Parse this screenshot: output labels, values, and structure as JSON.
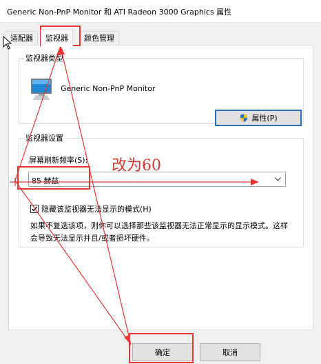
{
  "window": {
    "title": "Generic Non-PnP Monitor 和 ATI Radeon 3000 Graphics 属性"
  },
  "tabs": [
    {
      "label": "适配器"
    },
    {
      "label": "监视器"
    },
    {
      "label": "颜色管理"
    }
  ],
  "monitor_type": {
    "legend": "监视器类型",
    "name": "Generic Non-PnP Monitor",
    "properties_label": "属性(P)"
  },
  "monitor_settings": {
    "legend": "监视器设置",
    "refresh_label": "屏幕刷新频率(S):",
    "refresh_value": "85 赫兹",
    "hide_modes_label": "隐藏该监视器无法显示的模式(H)",
    "hide_modes_checked": true,
    "description": "如果不复选该项，则你可以选择那些该监视器无法正常显示的显示模式。这样会导致无法显示并且/或者损坏硬件。"
  },
  "buttons": {
    "ok_label": "确定",
    "cancel_label": "取消"
  },
  "annotation": {
    "text": "改为60",
    "color": "#d33a2f"
  }
}
